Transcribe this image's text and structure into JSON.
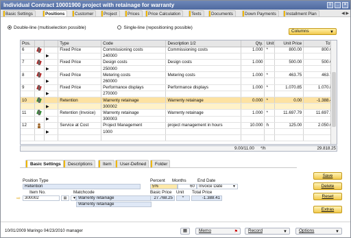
{
  "window": {
    "title": "Individual Contract 10001900 project with retainage for warranty"
  },
  "tabs": [
    "Basic Settings",
    "Positions",
    "Customer",
    "Project",
    "Prices",
    "Price Calculation",
    "Texts",
    "Documents",
    "Down Payments",
    "Installment Plan"
  ],
  "active_tab": "Positions",
  "radio": {
    "double_line": "Double-line (multiselection possible)",
    "single_line": "Single-line (repositioning possible)",
    "selected": "double_line"
  },
  "columns_button": "Columns",
  "grid": {
    "headers": [
      "Pos.",
      "",
      "",
      "Type",
      "Code",
      "Description 1/2",
      "Qty.",
      "Unit",
      "Unit Price",
      "Total"
    ],
    "rows": [
      {
        "pos": "6",
        "type": "Fixed Price",
        "code": "Commissioning costs",
        "desc": "Commissioning costs",
        "qty": "1.000",
        "unit": "*",
        "price": "800.00",
        "total": "800.00",
        "icon": "tools-icon"
      },
      {
        "pos": "",
        "type": "",
        "code": "240000",
        "desc": "",
        "qty": "",
        "unit": "",
        "price": "",
        "total": "",
        "icon": ""
      },
      {
        "pos": "7",
        "type": "Fixed Price",
        "code": "Design costs",
        "desc": "Design costs",
        "qty": "1.000",
        "unit": "",
        "price": "500.00",
        "total": "500.00",
        "icon": "tools-icon"
      },
      {
        "pos": "",
        "type": "",
        "code": "250000",
        "desc": "",
        "qty": "",
        "unit": "",
        "price": "",
        "total": "",
        "icon": ""
      },
      {
        "pos": "8",
        "type": "Fixed Price",
        "code": "Metering costs",
        "desc": "Metering costs",
        "qty": "1.000",
        "unit": "*",
        "price": "463.75",
        "total": "463.75",
        "icon": "tools-icon"
      },
      {
        "pos": "",
        "type": "",
        "code": "260000",
        "desc": "",
        "qty": "",
        "unit": "",
        "price": "",
        "total": "",
        "icon": ""
      },
      {
        "pos": "9",
        "type": "Fixed Price",
        "code": "Performance displays",
        "desc": "Performance displays",
        "qty": "1.000",
        "unit": "*",
        "price": "1.070.85",
        "total": "1.070.85",
        "icon": "tools-icon"
      },
      {
        "pos": "",
        "type": "",
        "code": "270000",
        "desc": "",
        "qty": "",
        "unit": "",
        "price": "",
        "total": "",
        "icon": ""
      },
      {
        "pos": "10",
        "type": "Retention",
        "code": "Warrenty retainage",
        "desc": "Warrenty retainage",
        "qty": "0.000",
        "unit": "*",
        "price": "0.00",
        "total": "-1.388.41",
        "icon": "retention-icon",
        "hl": "hl"
      },
      {
        "pos": "",
        "type": "",
        "code": "300002",
        "desc": "",
        "qty": "",
        "unit": "",
        "price": "",
        "total": "",
        "icon": "",
        "hl": "hl2"
      },
      {
        "pos": "11",
        "type": "Retention (Invoice)",
        "code": "Warrenty retainage",
        "desc": "Warrenty retainage",
        "qty": "1.000",
        "unit": "*",
        "price": "11.697.79",
        "total": "11.697.79",
        "icon": "retention-icon"
      },
      {
        "pos": "",
        "type": "",
        "code": "300003",
        "desc": "",
        "qty": "",
        "unit": "",
        "price": "",
        "total": "",
        "icon": ""
      },
      {
        "pos": "12",
        "type": "Service at Cost",
        "code": "Project Management",
        "desc": "project management in hours",
        "qty": "10.000",
        "unit": "h",
        "price": "125.00",
        "total": "2.050.00",
        "icon": "person-icon",
        "sigma": "Σ"
      },
      {
        "pos": "",
        "type": "",
        "code": "1000",
        "desc": "",
        "qty": "",
        "unit": "",
        "price": "",
        "total": "",
        "icon": ""
      },
      {
        "pos": "",
        "type": "",
        "code": "",
        "desc": "",
        "qty": "",
        "unit": "",
        "price": "",
        "total": "",
        "icon": ""
      }
    ],
    "summary": {
      "qty": "9.00/11.00",
      "unit": "*/h",
      "total": "29.818.25"
    }
  },
  "subtabs": [
    "Basic Settings",
    "Descriptions",
    "Item",
    "User-Defined",
    "Folder"
  ],
  "active_subtab": "Basic Settings",
  "detail": {
    "position_type_label": "Position Type",
    "position_type_value": "Retention",
    "percent_label": "Percent",
    "percent_value": "5%",
    "months_label": "Months",
    "months_value": "60",
    "end_date_label": "End Date",
    "end_date_value": "Invoice Date",
    "item_no_label": "Item No.",
    "item_no_value": "300002",
    "matchcode_label": "Matchcode",
    "matchcode_value": "Warrenty retainage",
    "matchcode_value2": "Warrenty retainage",
    "basic_price_label": "Basic Price",
    "basic_price_value": "27.768.25",
    "unit_label": "Unit",
    "unit_value": "*",
    "total_price_label": "Total Price",
    "total_price_value": "-1.388.41"
  },
  "buttons": {
    "save": "Save",
    "delete": "Delete",
    "reset": "Reset",
    "extras": "Extras"
  },
  "status": {
    "text": "10/01/2009 Maringo  04/23/2010 manager"
  },
  "bottom": {
    "memo": "Memo",
    "record": "Record",
    "options": "Options"
  }
}
